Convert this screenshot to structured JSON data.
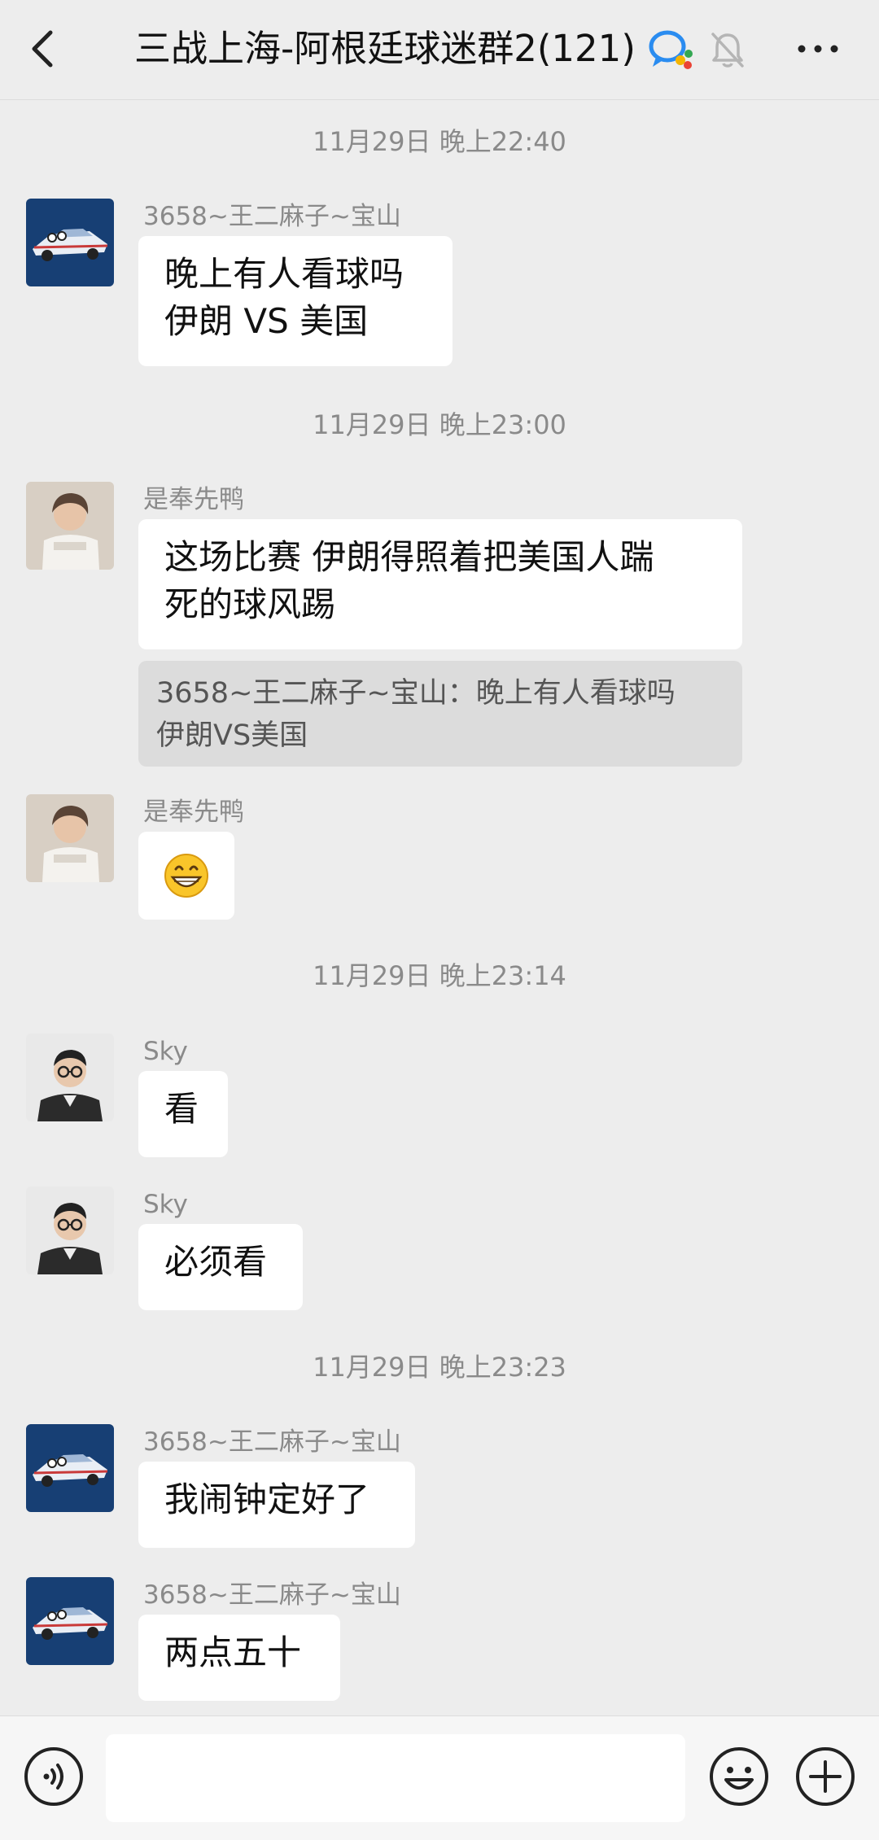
{
  "header": {
    "title": "三战上海-阿根廷球迷群2(121)"
  },
  "messages": [
    {
      "type": "timestamp",
      "text": "11月29日 晚上22:40"
    },
    {
      "type": "message",
      "sender": "3658~王二麻子~宝山",
      "avatar": "car-avatar",
      "text": "晚上有人看球吗\n伊朗 VS 美国"
    },
    {
      "type": "timestamp",
      "text": "11月29日 晚上23:00"
    },
    {
      "type": "message",
      "sender": "是奉先鸭",
      "avatar": "person-shirt-avatar",
      "text": "这场比赛 伊朗得照着把美国人踹\n死的球风踢",
      "quote": "3658~王二麻子~宝山：晚上有人看球吗\n伊朗VS美国"
    },
    {
      "type": "message",
      "sender": "是奉先鸭",
      "avatar": "person-shirt-avatar",
      "emoji": "grinning-face"
    },
    {
      "type": "timestamp",
      "text": "11月29日 晚上23:14"
    },
    {
      "type": "message",
      "sender": "Sky",
      "avatar": "person-glasses-avatar",
      "text": "看"
    },
    {
      "type": "message",
      "sender": "Sky",
      "avatar": "person-glasses-avatar",
      "text": "必须看"
    },
    {
      "type": "timestamp",
      "text": "11月29日 晚上23:23"
    },
    {
      "type": "message",
      "sender": "3658~王二麻子~宝山",
      "avatar": "car-avatar",
      "text": "我闹钟定好了"
    },
    {
      "type": "message",
      "sender": "3658~王二麻子~宝山",
      "avatar": "car-avatar",
      "text": "两点五十"
    }
  ],
  "input": {
    "value": ""
  },
  "colors": {
    "background": "#ededed",
    "bubble": "#ffffff",
    "quote_bg": "#dcdcdc",
    "timestamp": "#8a8a8a",
    "avatar_blue": "#173f74"
  }
}
